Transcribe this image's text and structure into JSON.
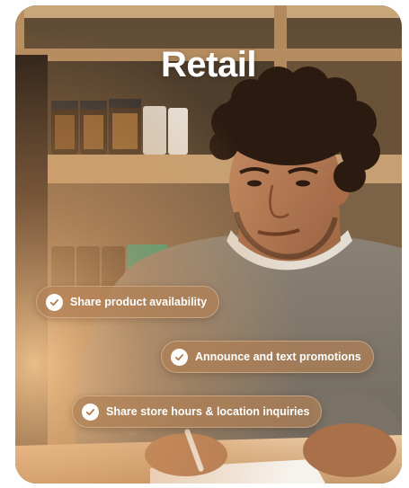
{
  "card": {
    "title": "Retail",
    "features": [
      {
        "label": "Share product availability",
        "icon": "check-circle-icon"
      },
      {
        "label": "Announce and text promotions",
        "icon": "check-circle-icon"
      },
      {
        "label": "Share store hours & location inquiries",
        "icon": "check-circle-icon"
      }
    ]
  },
  "colors": {
    "pill_background": "#b08054",
    "check_color": "#b07a4c",
    "title_color": "#ffffff"
  }
}
